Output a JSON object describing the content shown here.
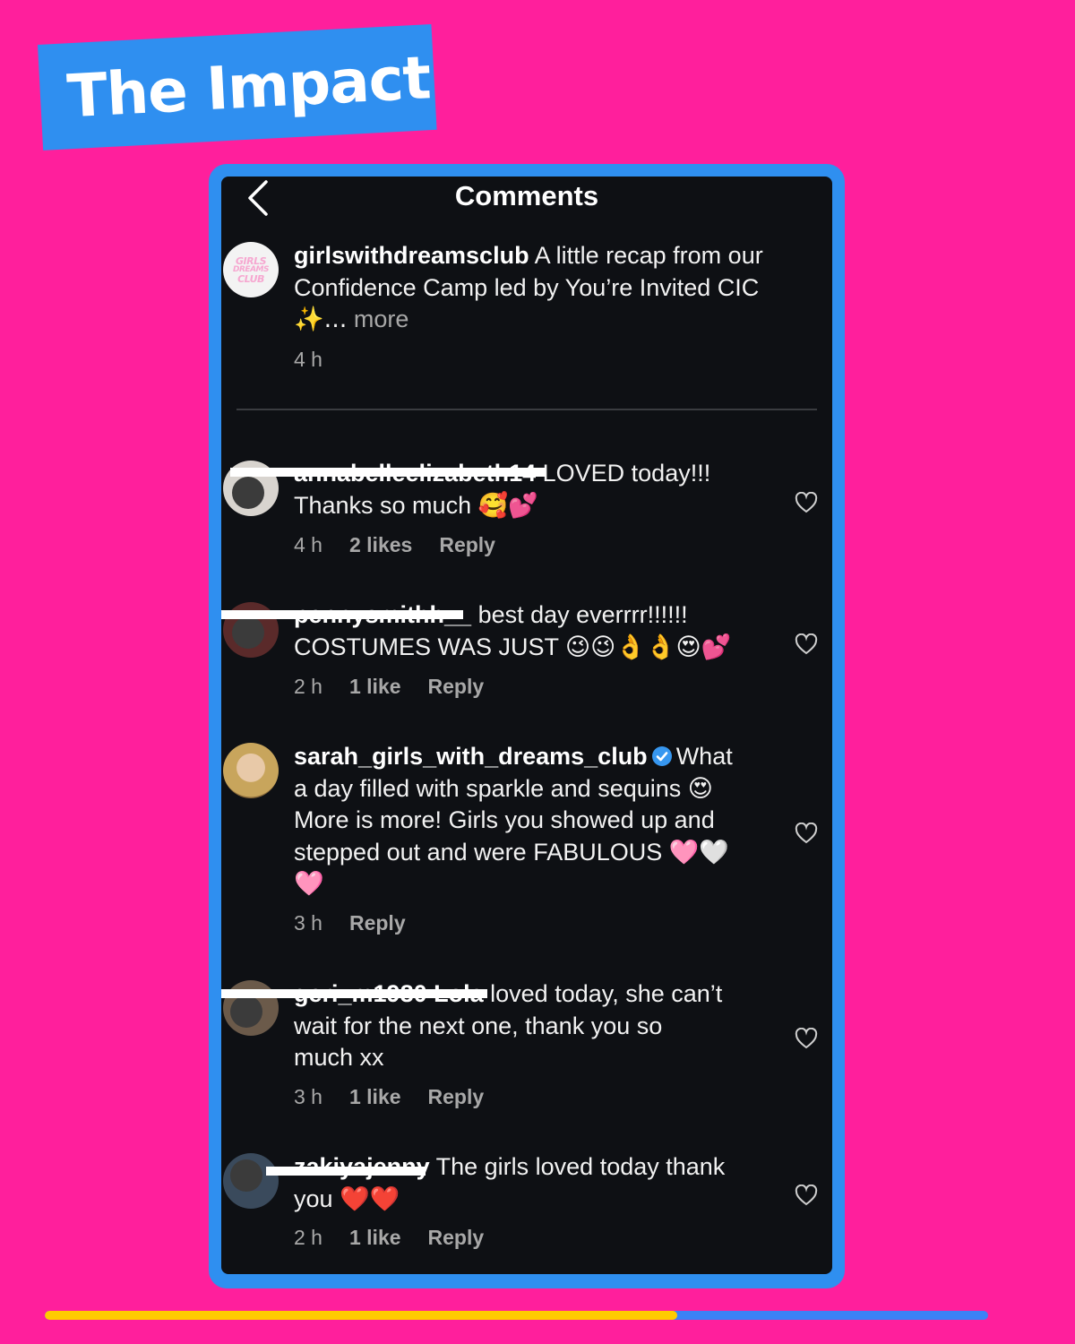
{
  "banner": {
    "title": "The Impact"
  },
  "screen": {
    "title": "Comments"
  },
  "post": {
    "username": "girlswithdreamsclub",
    "text": "A little recap from our Confidence Camp led by You’re Invited CIC",
    "emoji": "✨...",
    "more": "more",
    "time": "4 h",
    "avatar_logo": [
      "GIRLS",
      "DREAMS",
      "CLUB"
    ]
  },
  "comments": [
    {
      "username": "annabelleelizabeth14",
      "username_redacted": true,
      "text_line1": "LOVED today!!!",
      "text_line2": "Thanks so much 🥰💕",
      "time": "4 h",
      "likes": "2 likes",
      "reply": "Reply"
    },
    {
      "username": "pennysmithh__",
      "username_redacted": true,
      "text_line1": "best day everrrr!!!!!!",
      "text_line2": "COSTUMES WAS JUST 😉😉👌👌😍💕",
      "time": "2 h",
      "likes": "1 like",
      "reply": "Reply"
    },
    {
      "username": "sarah_girls_with_dreams_club",
      "verified": true,
      "text_line1": "What",
      "text_line2": "a day filled with sparkle and sequins 😍",
      "text_line3": "More is more! Girls you showed up and",
      "text_line4": "stepped out and were FABULOUS 🩷🤍",
      "text_line5": "🩷",
      "time": "3 h",
      "reply": "Reply"
    },
    {
      "username": "geri_m1980 Lola",
      "username_redacted": true,
      "text_line1": "loved today, she can’t",
      "text_line2": "wait for the next one, thank you so",
      "text_line3": "much xx",
      "time": "3 h",
      "likes": "1 like",
      "reply": "Reply"
    },
    {
      "username": "zakiyajenny",
      "username_redacted": true,
      "text_line1": "The girls loved today thank",
      "text_line2": "you ❤️❤️",
      "time": "2 h",
      "likes": "1 like",
      "reply": "Reply"
    }
  ],
  "progress": {
    "fraction": 0.67
  },
  "colors": {
    "background": "#ff1f9c",
    "banner": "#2f8ff0",
    "frame": "#2f8ff0",
    "screen": "#0e1014",
    "progress_fill": "#ffcc00",
    "progress_track": "#3b82f6",
    "verified": "#3797f0"
  },
  "icons": [
    "back-chevron-icon",
    "heart-outline-icon",
    "verified-badge-icon"
  ]
}
